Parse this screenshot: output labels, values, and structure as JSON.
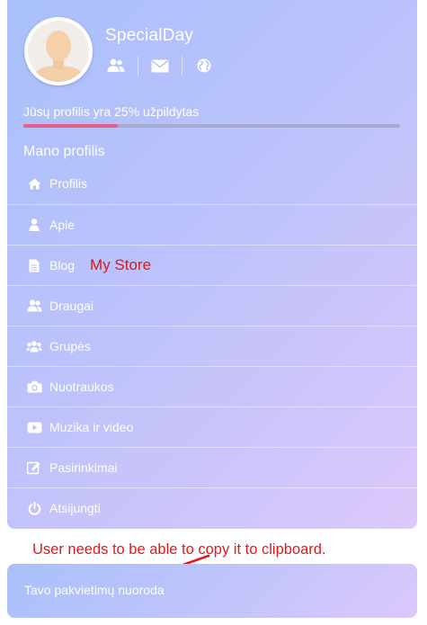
{
  "profile": {
    "username": "SpecialDay",
    "quick_links": [
      {
        "icon": "friends-icon"
      },
      {
        "icon": "envelope-icon"
      },
      {
        "icon": "globe-icon"
      }
    ]
  },
  "completion": {
    "label": "Jūsų profilis yra 25% užpildytas",
    "percent": 25,
    "color_fill": "#e85d86"
  },
  "menu": {
    "title": "Mano profilis",
    "items": [
      {
        "label": "Profilis",
        "icon": "home-icon"
      },
      {
        "label": "Apie",
        "icon": "user-icon"
      },
      {
        "label": "Blog",
        "icon": "file-icon",
        "note": "My Store"
      },
      {
        "label": "Draugai",
        "icon": "friends-icon"
      },
      {
        "label": "Grupės",
        "icon": "group-icon"
      },
      {
        "label": "Nuotraukos",
        "icon": "camera-icon"
      },
      {
        "label": "Muzika ir video",
        "icon": "youtube-icon"
      },
      {
        "label": "Pasirinkimai",
        "icon": "edit-icon"
      },
      {
        "label": "Atsijungti",
        "icon": "power-icon"
      }
    ]
  },
  "annotation": {
    "text": "User needs to be able to copy it to clipboard.",
    "color": "#e0191c"
  },
  "invite": {
    "label": "Tavo pakvietimų nuoroda"
  }
}
